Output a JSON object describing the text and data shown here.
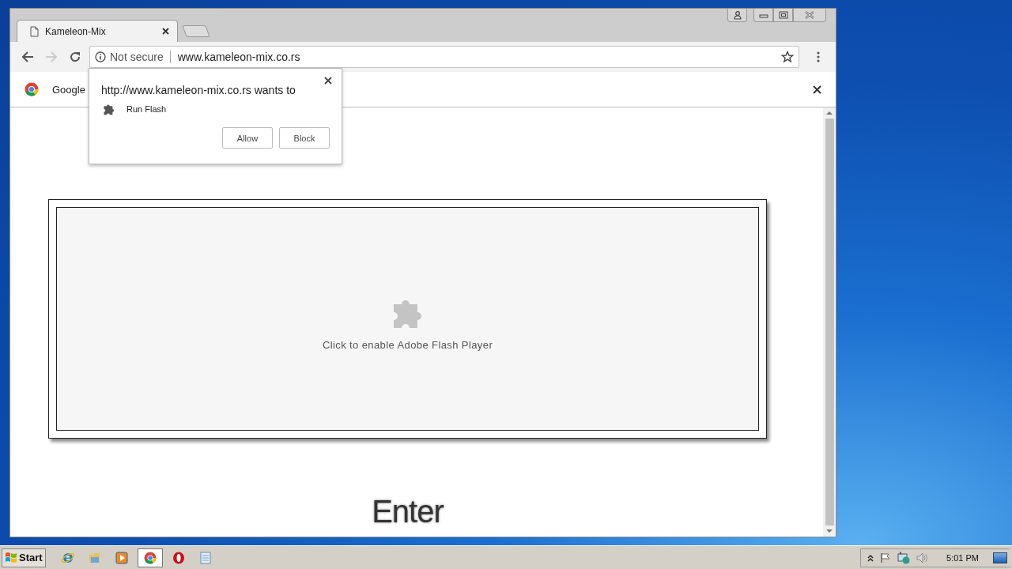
{
  "tabs": [
    {
      "title": "Kameleon-Mix",
      "selected": true
    }
  ],
  "address_bar": {
    "security": "Not secure",
    "url": "www.kameleon-mix.co.rs"
  },
  "infobar": {
    "text": "Google"
  },
  "popup": {
    "message": "http://www.kameleon-mix.co.rs wants to",
    "permission": "Run Flash",
    "buttons": [
      "Allow",
      "Block"
    ]
  },
  "page": {
    "plugin_text": "Click to enable Adobe Flash Player",
    "heading": "Enter"
  },
  "taskbar": {
    "start": "Start",
    "apps": [
      {
        "kind": "ie",
        "selected": false
      },
      {
        "kind": "explorer",
        "selected": false
      },
      {
        "kind": "media",
        "selected": false
      },
      {
        "kind": "chrome",
        "selected": true
      },
      {
        "kind": "opera",
        "selected": false
      },
      {
        "kind": "notepad",
        "selected": false
      }
    ],
    "clock": "5:01 PM"
  }
}
